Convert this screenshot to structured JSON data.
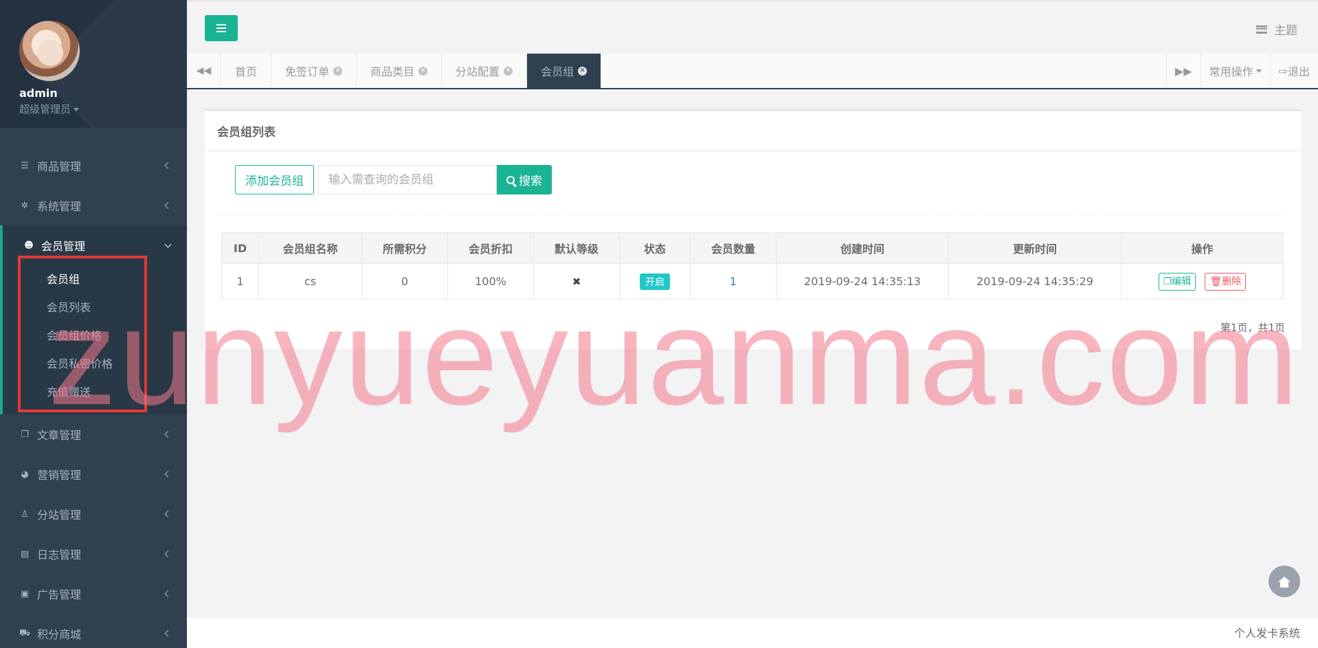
{
  "profile": {
    "name": "admin",
    "role": "超级管理员"
  },
  "sidebar": {
    "items": [
      {
        "label": "商品管理",
        "icon": "bars-icon"
      },
      {
        "label": "系统管理",
        "icon": "gear-icon"
      },
      {
        "label": "会员管理",
        "icon": "users-icon",
        "expanded": true,
        "children": [
          {
            "label": "会员组",
            "current": true
          },
          {
            "label": "会员列表"
          },
          {
            "label": "会员组价格"
          },
          {
            "label": "会员私密价格"
          },
          {
            "label": "充值赠送"
          }
        ]
      },
      {
        "label": "文章管理",
        "icon": "copy-icon"
      },
      {
        "label": "营销管理",
        "icon": "pie-chart-icon"
      },
      {
        "label": "分站管理",
        "icon": "child-icon"
      },
      {
        "label": "日志管理",
        "icon": "tasks-icon"
      },
      {
        "label": "广告管理",
        "icon": "image-icon"
      },
      {
        "label": "积分商城",
        "icon": "cart-icon"
      }
    ]
  },
  "topbar": {
    "theme_label": "主题"
  },
  "tabs": {
    "items": [
      {
        "label": "首页",
        "closable": false
      },
      {
        "label": "免签订单",
        "closable": true
      },
      {
        "label": "商品类目",
        "closable": true
      },
      {
        "label": "分站配置",
        "closable": true
      },
      {
        "label": "会员组",
        "closable": true,
        "active": true
      }
    ],
    "common_ops": "常用操作",
    "logout": "退出"
  },
  "panel": {
    "title": "会员组列表",
    "add_button": "添加会员组",
    "search_placeholder": "输入需查询的会员组",
    "search_button": "搜索"
  },
  "table": {
    "headers": [
      "ID",
      "会员组名称",
      "所需积分",
      "会员折扣",
      "默认等级",
      "状态",
      "会员数量",
      "创建时间",
      "更新时间",
      "操作"
    ],
    "rows": [
      {
        "id": "1",
        "name": "cs",
        "points": "0",
        "discount": "100%",
        "default_level": "✖",
        "status": "开启",
        "member_count": "1",
        "created": "2019-09-24 14:35:13",
        "updated": "2019-09-24 14:35:29",
        "edit": "编辑",
        "delete": "删除"
      }
    ]
  },
  "pagination": "第1页，共1页",
  "footer": "个人发卡系统",
  "watermark": "zunyueyuanma.com",
  "colors": {
    "sidebar_bg": "#2f4050",
    "accent": "#1ab394",
    "danger": "#ed5565",
    "info": "#23c6c8"
  }
}
